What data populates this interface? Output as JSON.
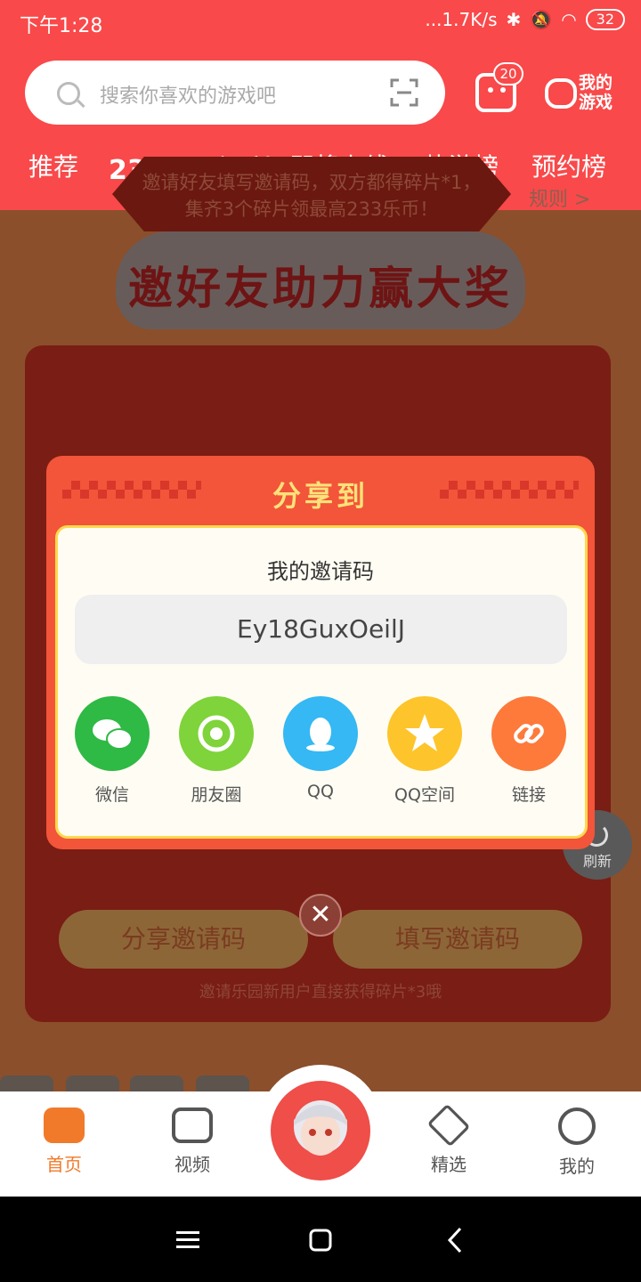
{
  "status_bar": {
    "time": "下午1:28",
    "network": "...1.7K/s",
    "battery": "32"
  },
  "search": {
    "placeholder": "搜索你喜欢的游戏吧"
  },
  "header": {
    "message_badge": "20",
    "my_games_label": "我的游戏"
  },
  "tabs": [
    {
      "label": "推荐",
      "active": false
    },
    {
      "label": "233百万福利",
      "active": true
    },
    {
      "label": "即将上线",
      "active": false
    },
    {
      "label": "热游榜",
      "active": false
    },
    {
      "label": "预约榜",
      "active": false
    }
  ],
  "promo": {
    "title": "邀好友助力赢大奖",
    "banner_text": "邀请好友填写邀请码，双方都得碎片*1，集齐3个碎片领最高233乐币！",
    "rules_link": "规则 >",
    "refresh_label": "刷新",
    "share_code_button": "分享邀请码",
    "fill_code_button": "填写邀请码",
    "note": "邀请乐园新用户直接获得碎片*3哦"
  },
  "popup": {
    "title": "分享到",
    "code_label": "我的邀请码",
    "invite_code": "Ey18GuxOeilJ",
    "share_options": [
      {
        "label": "微信",
        "icon": "wechat-icon",
        "color": "#2fb945"
      },
      {
        "label": "朋友圈",
        "icon": "moments-icon",
        "color": "#7fd33b"
      },
      {
        "label": "QQ",
        "icon": "qq-icon",
        "color": "#35b8f3"
      },
      {
        "label": "QQ空间",
        "icon": "qzone-icon",
        "color": "#fdc52b"
      },
      {
        "label": "链接",
        "icon": "link-icon",
        "color": "#fd7a3b"
      }
    ],
    "close": "✕"
  },
  "bottom_nav": [
    {
      "label": "首页",
      "active": true
    },
    {
      "label": "视频",
      "active": false
    },
    {
      "label": "精选",
      "active": false
    },
    {
      "label": "我的",
      "active": false
    }
  ],
  "colors": {
    "brand": "#f9494a",
    "active_nav": "#f07a2a"
  }
}
